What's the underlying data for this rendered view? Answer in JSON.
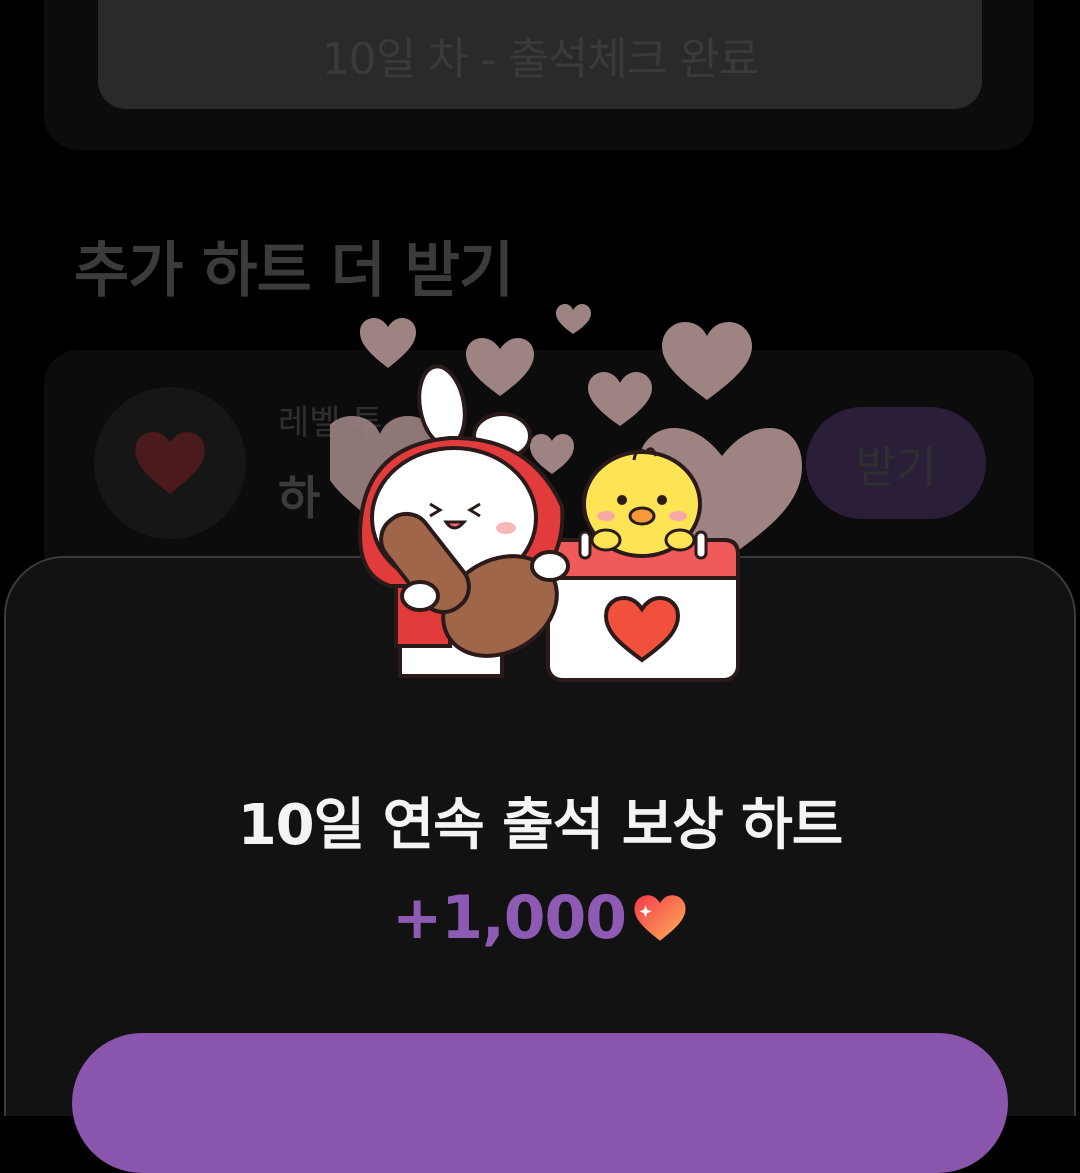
{
  "background": {
    "checkin_status": "10일 차 - 출석체크 완료",
    "section_title": "추가 하트 더 받기",
    "reward_row": {
      "subtitle": "레벨 투",
      "title": "하",
      "receive_button": "받기",
      "icon": "heart-icon"
    }
  },
  "illustration": {
    "characters": [
      "bunny-character",
      "chick-character",
      "calendar-heart-icon",
      "stamp-icon"
    ]
  },
  "sheet": {
    "title": "10일 연속 출석 보상 하트",
    "reward_amount": "+1,000",
    "reward_icon": "heart-icon",
    "confirm_button": ""
  },
  "colors": {
    "accent": "#8a55ad",
    "reward_text": "#8d5bb3",
    "sheet_bg": "#121212"
  }
}
